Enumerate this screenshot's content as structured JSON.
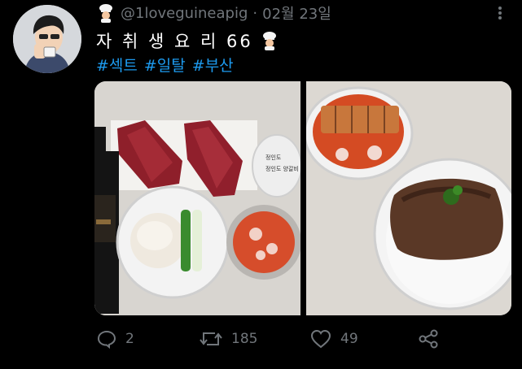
{
  "tweet": {
    "handle": "@1loveguineapig",
    "separator": "·",
    "date": "02월 23일",
    "title": "자 취 생 요 리 66",
    "hashtags": [
      "#섹트",
      "#일탈",
      "#부산"
    ],
    "icons": {
      "author_emoji": "chef-icon",
      "title_emoji": "chef-icon",
      "more": "more-vertical-icon"
    }
  },
  "media": {
    "left_photo_label_text": "정인도 양갈비"
  },
  "actions": {
    "reply_count": "2",
    "retweet_count": "185",
    "like_count": "49",
    "icons": [
      "reply-icon",
      "retweet-icon",
      "like-icon",
      "share-icon"
    ]
  },
  "colors": {
    "background": "#000000",
    "text": "#e7e9ea",
    "muted": "#71767b",
    "link": "#1d9bf0"
  }
}
